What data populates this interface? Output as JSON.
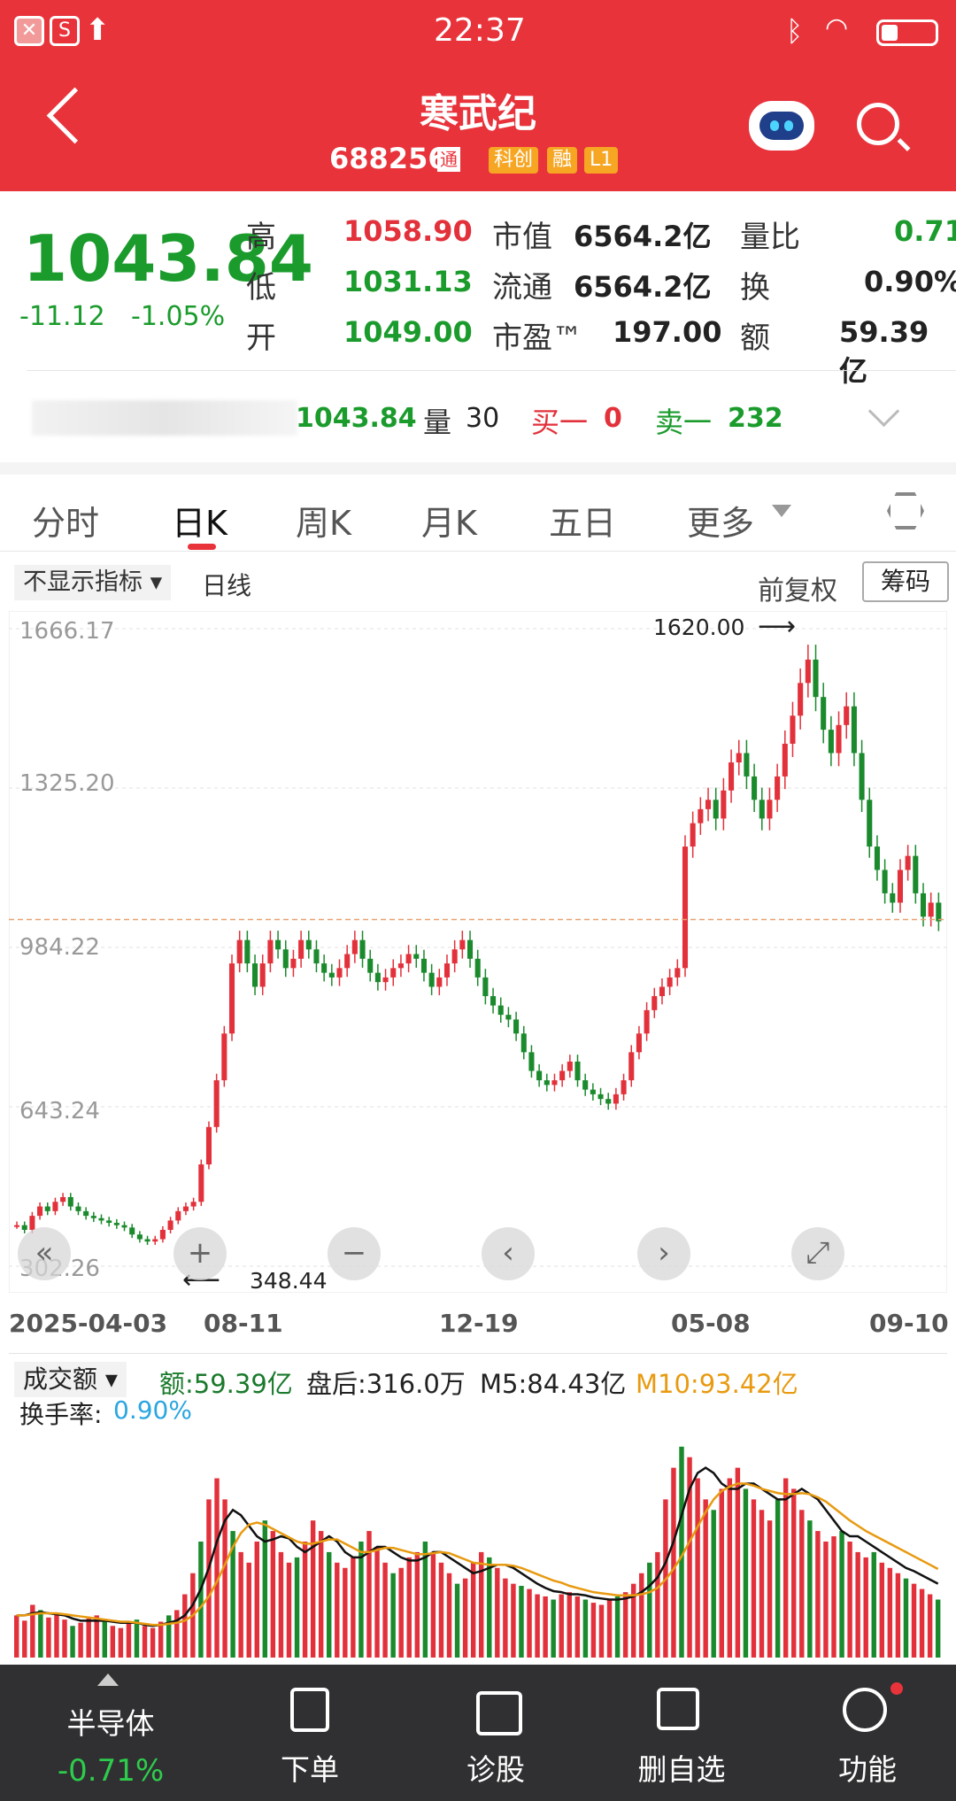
{
  "status_bar": {
    "time": "22:37"
  },
  "header": {
    "title": "寒武纪",
    "code": "688256",
    "tags": [
      "科创",
      "融",
      "L1"
    ],
    "tag_connect": "通"
  },
  "quote": {
    "price": "1043.84",
    "change": "-11.12",
    "change_pct": "-1.05%",
    "high_label": "高",
    "high": "1058.90",
    "low_label": "低",
    "low": "1031.13",
    "open_label": "开",
    "open": "1049.00",
    "mcap_label": "市值",
    "mcap": "6564.2亿",
    "float_label": "流通",
    "float": "6564.2亿",
    "pe_label": "市盈™",
    "pe": "197.00",
    "vr_label": "量比",
    "vr": "0.71",
    "turn_label": "换",
    "turn": "0.90%",
    "amt_label": "额",
    "amt": "59.39亿"
  },
  "tick": {
    "price": "1043.84",
    "vol_label": "量",
    "vol": "30",
    "bid_label": "买一",
    "bid": "0",
    "ask_label": "卖一",
    "ask": "232"
  },
  "tabs": [
    "分时",
    "日K",
    "周K",
    "月K",
    "五日",
    "更多"
  ],
  "chart_controls": {
    "indicator": "不显示指标",
    "period": "日线",
    "adjust": "前复权",
    "chip": "筹码"
  },
  "chart_data": [
    {
      "type": "candlestick",
      "title": "",
      "y_ticks": [
        "1666.17",
        "1325.20",
        "984.22",
        "643.24",
        "302.26"
      ],
      "x_ticks": [
        "2025-04-03",
        "08-11",
        "12-19",
        "05-08",
        "09-10"
      ],
      "ylim": [
        302.26,
        1666.17
      ],
      "annotations": {
        "max": "1620.00",
        "min": "348.44"
      },
      "current_line": 1043.84,
      "close_series": [
        390,
        380,
        410,
        430,
        420,
        440,
        450,
        430,
        420,
        410,
        405,
        400,
        395,
        390,
        385,
        370,
        360,
        355,
        360,
        380,
        400,
        420,
        430,
        440,
        520,
        600,
        700,
        800,
        950,
        1000,
        950,
        900,
        950,
        1000,
        980,
        940,
        960,
        1000,
        980,
        950,
        930,
        920,
        940,
        970,
        1000,
        960,
        930,
        910,
        920,
        940,
        950,
        970,
        960,
        930,
        900,
        920,
        950,
        980,
        1000,
        960,
        920,
        880,
        860,
        840,
        830,
        800,
        760,
        720,
        700,
        690,
        700,
        720,
        740,
        700,
        680,
        670,
        660,
        650,
        670,
        700,
        760,
        800,
        850,
        880,
        900,
        920,
        940,
        1200,
        1250,
        1280,
        1300,
        1260,
        1320,
        1380,
        1400,
        1350,
        1300,
        1260,
        1300,
        1350,
        1420,
        1480,
        1550,
        1600,
        1520,
        1450,
        1400,
        1460,
        1500,
        1400,
        1300,
        1200,
        1150,
        1100,
        1080,
        1150,
        1180,
        1100,
        1050,
        1080,
        1040
      ]
    },
    {
      "type": "bar",
      "title": "成交额",
      "legend": {
        "amount": "额:59.39亿",
        "after_hours": "盘后:316.0万",
        "m5": "M5:84.43亿",
        "m10": "M10:93.42亿",
        "turnover_label": "换手率:",
        "turnover": "0.90%"
      },
      "volume_series": [
        40,
        35,
        50,
        45,
        38,
        42,
        36,
        30,
        33,
        37,
        40,
        35,
        30,
        28,
        32,
        36,
        30,
        28,
        34,
        40,
        45,
        60,
        80,
        110,
        150,
        170,
        150,
        120,
        100,
        90,
        110,
        130,
        120,
        100,
        90,
        95,
        110,
        130,
        120,
        100,
        90,
        85,
        95,
        110,
        120,
        105,
        90,
        80,
        85,
        95,
        100,
        110,
        100,
        90,
        80,
        70,
        75,
        90,
        100,
        95,
        85,
        75,
        70,
        68,
        65,
        60,
        58,
        55,
        60,
        62,
        58,
        55,
        52,
        50,
        55,
        58,
        62,
        70,
        80,
        90,
        100,
        150,
        180,
        200,
        190,
        170,
        150,
        140,
        160,
        170,
        180,
        160,
        150,
        140,
        130,
        150,
        170,
        160,
        140,
        130,
        120,
        110,
        115,
        120,
        110,
        100,
        95,
        100,
        90,
        85,
        80,
        75,
        70,
        65,
        60,
        55
      ],
      "m5_series": [
        40,
        40,
        42,
        43,
        42,
        41,
        40,
        37,
        35,
        35,
        35,
        35,
        34,
        33,
        33,
        33,
        31,
        30,
        31,
        33,
        35,
        40,
        50,
        65,
        85,
        110,
        130,
        140,
        135,
        125,
        115,
        110,
        112,
        115,
        113,
        105,
        100,
        105,
        110,
        115,
        110,
        100,
        95,
        95,
        100,
        105,
        105,
        100,
        95,
        92,
        92,
        95,
        100,
        100,
        95,
        90,
        85,
        80,
        82,
        85,
        88,
        88,
        85,
        80,
        75,
        70,
        66,
        63,
        62,
        60,
        60,
        59,
        57,
        56,
        55,
        55,
        56,
        58,
        62,
        68,
        76,
        90,
        110,
        135,
        160,
        175,
        180,
        175,
        165,
        160,
        160,
        165,
        165,
        160,
        155,
        150,
        150,
        155,
        160,
        155,
        150,
        140,
        130,
        120,
        115,
        115,
        110,
        105,
        100,
        95,
        90,
        85,
        82,
        78,
        74,
        70
      ],
      "m10_series": [
        40,
        40,
        41,
        42,
        42,
        42,
        41,
        40,
        39,
        38,
        37,
        36,
        35,
        34,
        34,
        33,
        32,
        31,
        31,
        32,
        33,
        35,
        40,
        48,
        58,
        72,
        88,
        105,
        118,
        126,
        128,
        126,
        122,
        118,
        114,
        110,
        108,
        108,
        110,
        112,
        112,
        108,
        104,
        100,
        100,
        102,
        104,
        104,
        102,
        100,
        98,
        98,
        99,
        100,
        99,
        96,
        93,
        90,
        89,
        88,
        88,
        88,
        87,
        85,
        82,
        79,
        76,
        73,
        71,
        68,
        66,
        64,
        62,
        61,
        60,
        59,
        59,
        59,
        60,
        62,
        66,
        74,
        84,
        96,
        110,
        124,
        138,
        150,
        158,
        162,
        165,
        165,
        163,
        160,
        158,
        156,
        155,
        155,
        156,
        155,
        152,
        148,
        142,
        136,
        130,
        125,
        120,
        116,
        112,
        108,
        104,
        100,
        96,
        92,
        88,
        84
      ]
    }
  ],
  "bottom_bar": {
    "sector_name": "半导体",
    "sector_chg": "-0.71%",
    "items": [
      "下单",
      "诊股",
      "删自选",
      "功能"
    ]
  }
}
